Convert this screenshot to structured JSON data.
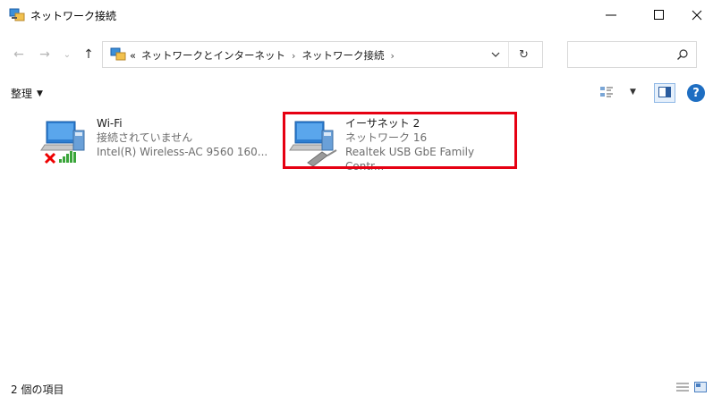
{
  "window": {
    "title": "ネットワーク接続",
    "minimize_glyph": "—",
    "maximize_glyph": "☐",
    "close_glyph": "✕"
  },
  "address": {
    "overflow": "«",
    "crumbs": [
      "ネットワークとインターネット",
      "ネットワーク接続"
    ],
    "search_placeholder": ""
  },
  "toolbar": {
    "organize_label": "整理",
    "icons": [
      "change-view-icon",
      "preview-pane-icon",
      "help-icon"
    ]
  },
  "connections": [
    {
      "name": "Wi-Fi",
      "status": "接続されていません",
      "device": "Intel(R) Wireless-AC 9560 160...",
      "icon": "wireless-adapter-disconnected-icon"
    },
    {
      "name": "イーサネット 2",
      "status": "ネットワーク 16",
      "device": "Realtek USB GbE Family Contr...",
      "icon": "ethernet-adapter-icon",
      "highlighted": true
    }
  ],
  "status_bar": {
    "item_count": "2 個の項目"
  },
  "colors": {
    "highlight_border": "#e60012",
    "accent": "#1e6ec2"
  }
}
